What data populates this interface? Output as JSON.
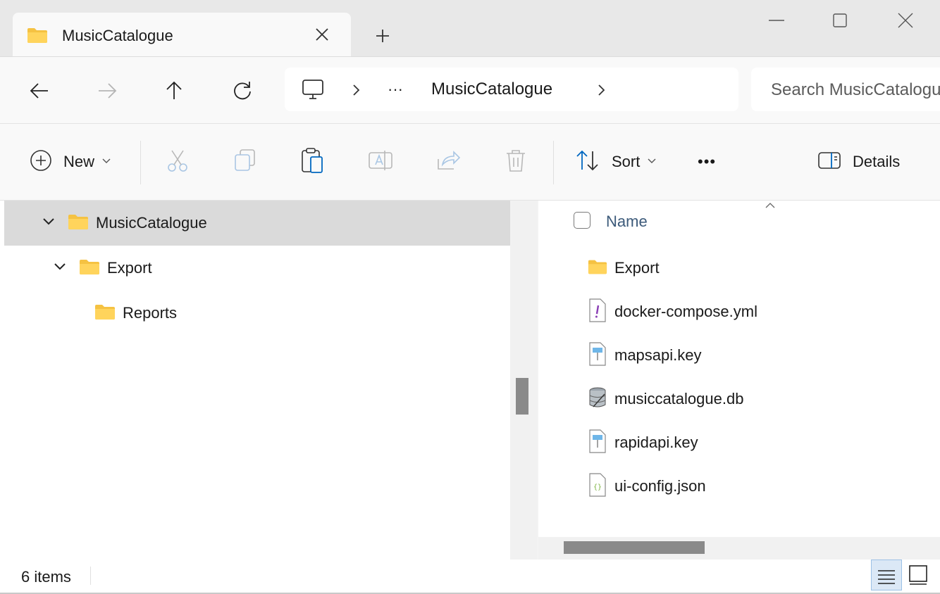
{
  "window": {
    "tab_title": "MusicCatalogue",
    "accent": "#0067c0",
    "folder_color": "#f5c242"
  },
  "caption": {
    "minimize_icon": "minimize-icon",
    "maximize_icon": "maximize-icon",
    "close_icon": "close-icon"
  },
  "nav": {
    "back_icon": "arrow-left-icon",
    "forward_icon": "arrow-right-icon",
    "up_icon": "arrow-up-icon",
    "refresh_icon": "refresh-icon"
  },
  "address": {
    "more": "···",
    "current": "MusicCatalogue"
  },
  "search": {
    "placeholder": "Search MusicCatalogue"
  },
  "toolbar": {
    "new_label": "New",
    "sort_label": "Sort",
    "more_label": "•••",
    "details_label": "Details"
  },
  "tree": [
    {
      "label": "MusicCatalogue",
      "expanded": true,
      "selected": true
    },
    {
      "label": "Export",
      "expanded": true,
      "selected": false
    },
    {
      "label": "Reports",
      "expanded": false,
      "selected": false
    }
  ],
  "content": {
    "column_name": "Name",
    "files": [
      {
        "name": "Export",
        "icon": "folder-icon"
      },
      {
        "name": "docker-compose.yml",
        "icon": "yml-file-icon"
      },
      {
        "name": "mapsapi.key",
        "icon": "key-file-icon"
      },
      {
        "name": "musiccatalogue.db",
        "icon": "database-file-icon"
      },
      {
        "name": "rapidapi.key",
        "icon": "key-file-icon"
      },
      {
        "name": "ui-config.json",
        "icon": "json-file-icon"
      }
    ]
  },
  "status": {
    "item_count": "6 items"
  }
}
